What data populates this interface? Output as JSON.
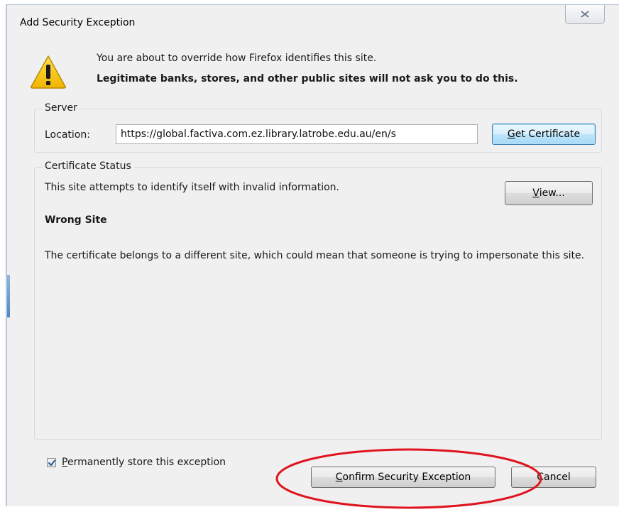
{
  "window": {
    "title": "Add Security Exception",
    "close_label": "✕"
  },
  "warning": {
    "icon": "warning-triangle-icon",
    "line1": "You are about to override how Firefox identifies this site.",
    "line2": "Legitimate banks, stores, and other public sites will not ask you to do this."
  },
  "server": {
    "group_label": "Server",
    "location_label": "Location:",
    "location_value": "https://global.factiva.com.ez.library.latrobe.edu.au/en/s",
    "get_certificate": {
      "mnemonic": "G",
      "rest": "et Certificate"
    }
  },
  "certificate_status": {
    "group_label": "Certificate Status",
    "status_text": "This site attempts to identify itself with invalid information.",
    "view_button": {
      "mnemonic": "V",
      "rest": "iew..."
    },
    "problem_title": "Wrong Site",
    "problem_description": "The certificate belongs to a different site, which could mean that someone is trying to impersonate this site."
  },
  "permanent": {
    "checked": true,
    "mnemonic": "P",
    "rest": "ermanently store this exception"
  },
  "buttons": {
    "confirm": {
      "mnemonic": "C",
      "rest": "onfirm Security Exception"
    },
    "cancel": "Cancel"
  },
  "colors": {
    "dialog_bg": "#f0f0f0",
    "annotation": "#e0141e",
    "warning_yellow": "#f5c400"
  }
}
